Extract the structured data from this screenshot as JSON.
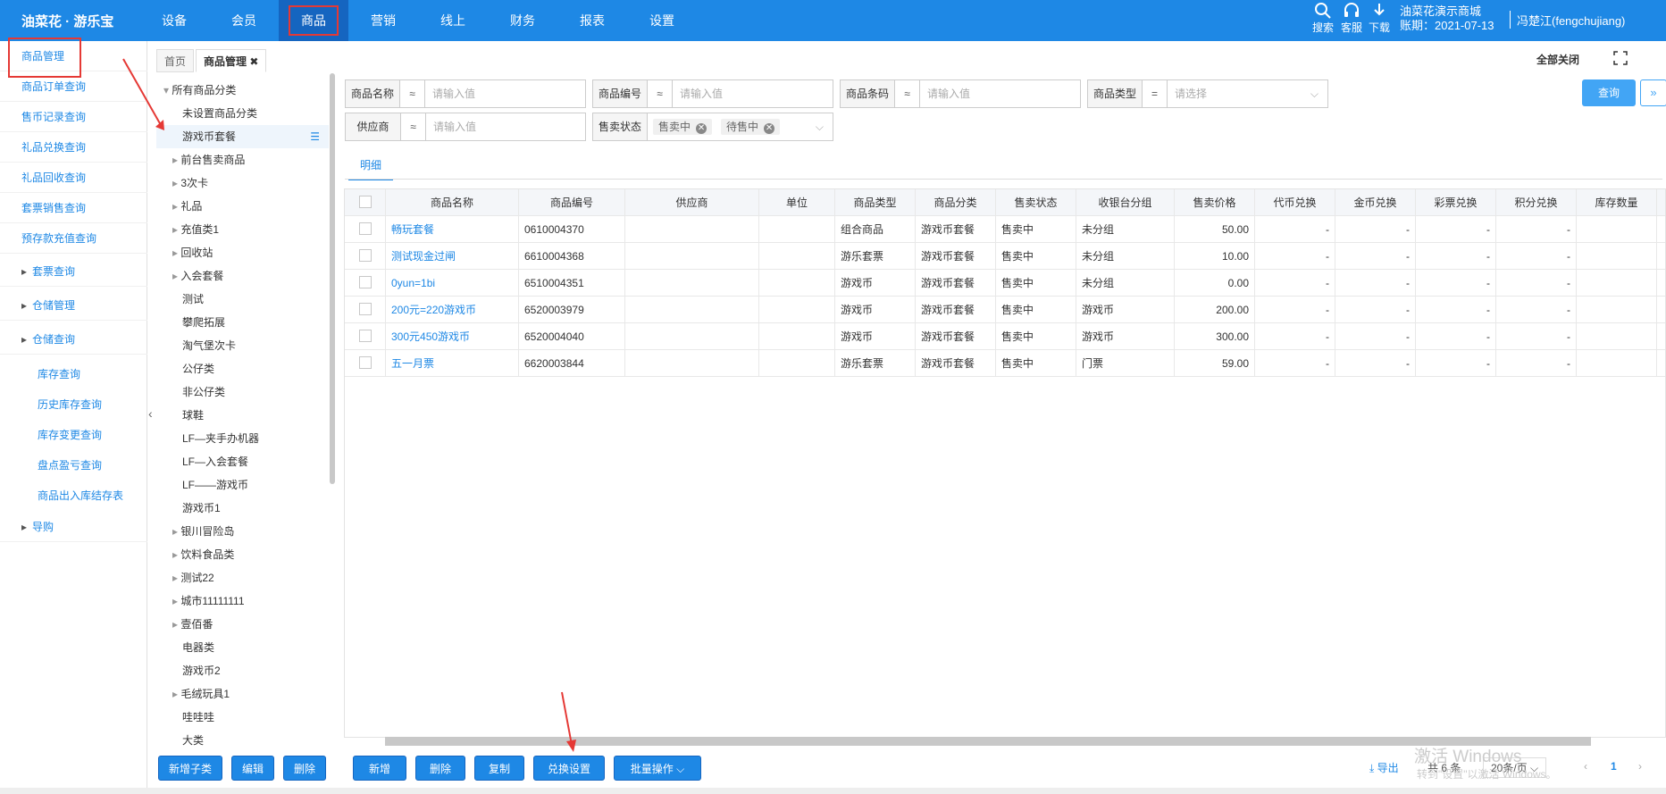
{
  "app": {
    "logo": "油菜花 · 游乐宝"
  },
  "nav": [
    "设备",
    "会员",
    "商品",
    "营销",
    "线上",
    "财务",
    "报表",
    "设置"
  ],
  "tools": [
    {
      "icon": "search-icon",
      "label": "搜索"
    },
    {
      "icon": "headset-icon",
      "label": "客服"
    },
    {
      "icon": "download-icon",
      "label": "下载"
    }
  ],
  "store": {
    "name": "油菜花演示商城",
    "expiry": "账期：2021-07-13"
  },
  "user": "冯楚江(fengchujiang)",
  "sidebar": [
    "商品管理",
    "商品订单查询",
    "售币记录查询",
    "礼品兑换查询",
    "礼品回收查询",
    "套票销售查询",
    "预存款充值查询",
    "套票查询",
    "仓储管理",
    "仓储查询",
    "库存查询",
    "历史库存查询",
    "库存变更查询",
    "盘点盈亏查询",
    "商品出入库结存表",
    "导购"
  ],
  "tabs": {
    "home": "首页",
    "active": "商品管理",
    "close_all": "全部关闭"
  },
  "tree": [
    "所有商品分类",
    "未设置商品分类",
    "游戏币套餐",
    "前台售卖商品",
    "3次卡",
    "礼品",
    "充值类1",
    "回收站",
    "入会套餐",
    "测试",
    "攀爬拓展",
    "淘气堡次卡",
    "公仔类",
    "非公仔类",
    "球鞋",
    "LF—夹手办机器",
    "LF—入会套餐",
    "LF——游戏币",
    "游戏币1",
    "银川冒险岛",
    "饮料食品类",
    "测试22",
    "城市11111111",
    "壹佰番",
    "电器类",
    "游戏币2",
    "毛绒玩具1",
    "哇哇哇",
    "大类"
  ],
  "tree_buttons": [
    "新增子类",
    "编辑",
    "删除"
  ],
  "filters": {
    "name": {
      "label": "商品名称",
      "op": "≈",
      "placeholder": "请输入值"
    },
    "code": {
      "label": "商品编号",
      "op": "≈",
      "placeholder": "请输入值"
    },
    "barcode": {
      "label": "商品条码",
      "op": "≈",
      "placeholder": "请输入值"
    },
    "type": {
      "label": "商品类型",
      "op": "=",
      "placeholder": "请选择"
    },
    "supplier": {
      "label": "供应商",
      "op": "≈",
      "placeholder": "请输入值"
    },
    "status": {
      "label": "售卖状态",
      "tags": [
        "售卖中",
        "待售中"
      ]
    }
  },
  "query_button": "查询",
  "subtab": "明细",
  "table": {
    "headers": [
      "商品名称",
      "商品编号",
      "供应商",
      "单位",
      "商品类型",
      "商品分类",
      "售卖状态",
      "收银台分组",
      "售卖价格",
      "代币兑换",
      "金币兑换",
      "彩票兑换",
      "积分兑换",
      "库存数量"
    ],
    "rows": [
      [
        "畅玩套餐",
        "0610004370",
        "",
        "",
        "组合商品",
        "游戏币套餐",
        "售卖中",
        "未分组",
        "50.00",
        "-",
        "-",
        "-",
        "-",
        ""
      ],
      [
        "测试现金过闸",
        "6610004368",
        "",
        "",
        "游乐套票",
        "游戏币套餐",
        "售卖中",
        "未分组",
        "10.00",
        "-",
        "-",
        "-",
        "-",
        ""
      ],
      [
        "0yun=1bi",
        "6510004351",
        "",
        "",
        "游戏币",
        "游戏币套餐",
        "售卖中",
        "未分组",
        "0.00",
        "-",
        "-",
        "-",
        "-",
        ""
      ],
      [
        "200元=220游戏币",
        "6520003979",
        "",
        "",
        "游戏币",
        "游戏币套餐",
        "售卖中",
        "游戏币",
        "200.00",
        "-",
        "-",
        "-",
        "-",
        ""
      ],
      [
        "300元450游戏币",
        "6520004040",
        "",
        "",
        "游戏币",
        "游戏币套餐",
        "售卖中",
        "游戏币",
        "300.00",
        "-",
        "-",
        "-",
        "-",
        ""
      ],
      [
        "五一月票",
        "6620003844",
        "",
        "",
        "游乐套票",
        "游戏币套餐",
        "售卖中",
        "门票",
        "59.00",
        "-",
        "-",
        "-",
        "-",
        ""
      ]
    ]
  },
  "bottom_buttons": [
    "新增",
    "删除",
    "复制",
    "兑换设置",
    "批量操作"
  ],
  "pager": {
    "export": "导出",
    "total": "共 6 条",
    "page_size": "20条/页",
    "page": "1"
  },
  "watermark": {
    "line1": "激活 Windows",
    "line2": "转到\"设置\"以激活 Windows。"
  }
}
